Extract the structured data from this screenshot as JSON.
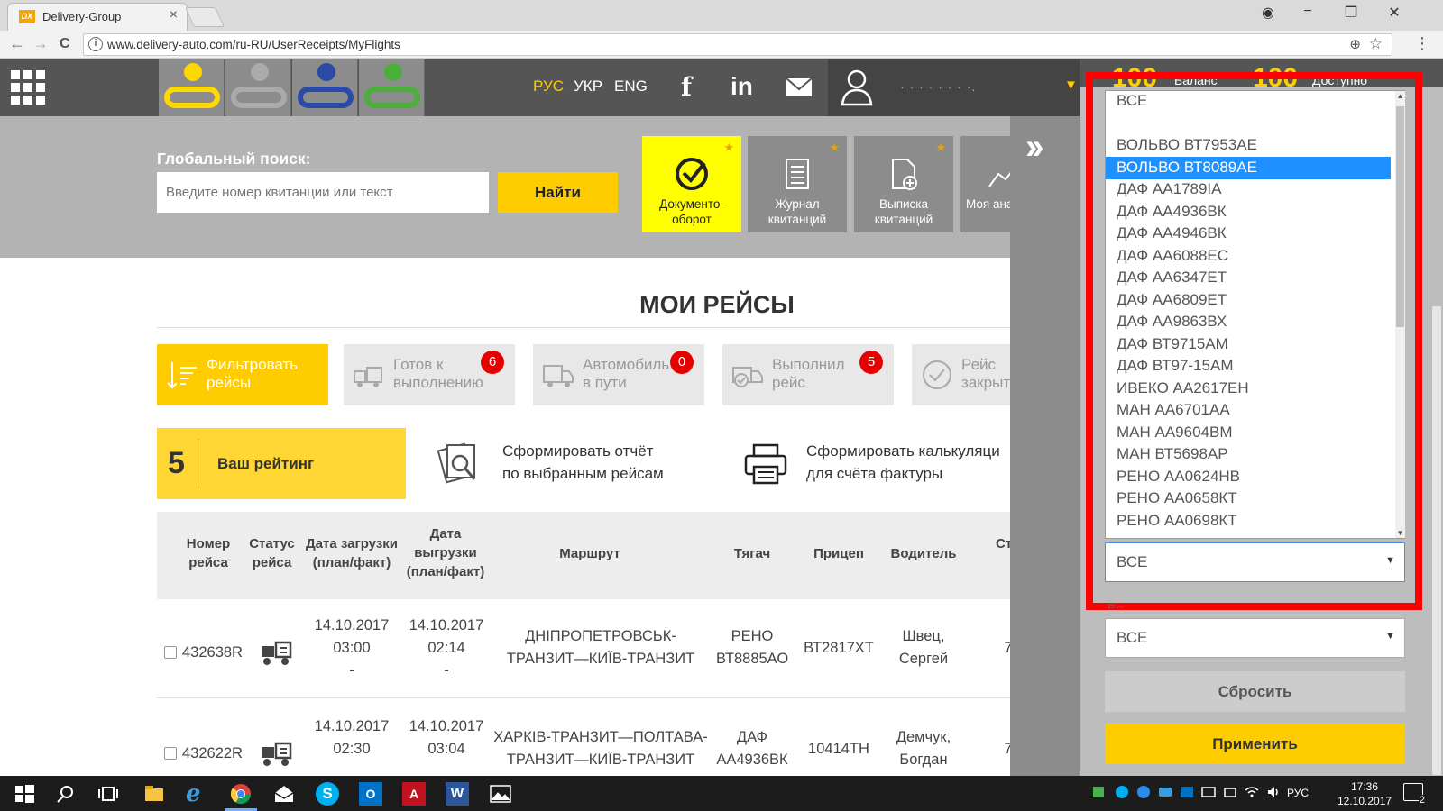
{
  "browser": {
    "tab_title": "Delivery-Group",
    "tab_close": "×",
    "url": "www.delivery-auto.com/ru-RU/UserReceipts/MyFlights",
    "nav_back": "←",
    "nav_forward": "→",
    "nav_reload": "C",
    "zoom_icon": "⊕",
    "star_icon": "☆",
    "menu_icon": "⋮",
    "win_user": "◉",
    "win_min": "−",
    "win_max": "❐",
    "win_close": "✕"
  },
  "header": {
    "lang_ru": "РУС",
    "lang_uk": "УКР",
    "lang_en": "ENG",
    "user_name": "· · ·  ·  ·  ·  · ·.",
    "user_dd": "▼",
    "colors": {
      "accent": "#ffcc00",
      "dark": "#555555"
    }
  },
  "search": {
    "label": "Глобальный поиск:",
    "placeholder": "Введите номер квитанции или текст",
    "button": "Найти"
  },
  "tiles": [
    {
      "l1": "Документо-",
      "l2": "оборот"
    },
    {
      "l1": "Журнал",
      "l2": "квитанций"
    },
    {
      "l1": "Выписка",
      "l2": "квитанций"
    },
    {
      "l1": "Моя ана",
      "l2": ""
    }
  ],
  "page_title": "МОИ РЕЙСЫ",
  "filters": [
    {
      "l1": "Фильтровать",
      "l2": "рейсы",
      "badge": ""
    },
    {
      "l1": "Готов к",
      "l2": "выполнению",
      "badge": "6"
    },
    {
      "l1": "Автомобиль",
      "l2": "в пути",
      "badge": "0"
    },
    {
      "l1": "Выполнил",
      "l2": "рейс",
      "badge": "5"
    },
    {
      "l1": "Рейс",
      "l2": "закрыт",
      "badge": ""
    }
  ],
  "rating": {
    "num": "5",
    "label": "Ваш рейтинг"
  },
  "actions": {
    "report_l1": "Сформировать отчёт",
    "report_l2": "по выбранным рейсам",
    "calc_l1": "Сформировать калькуляци",
    "calc_l2": "для счёта фактуры"
  },
  "table": {
    "headers": {
      "num_l1": "Номер",
      "num_l2": "рейса",
      "status_l1": "Статус",
      "status_l2": "рейса",
      "load_l1": "Дата загрузки",
      "load_l2": "(план/факт)",
      "unload_l1": "Дата",
      "unload_l2": "выгрузки",
      "unload_l3": "(план/факт)",
      "route": "Маршрут",
      "tractor": "Тягач",
      "trailer": "Прицеп",
      "driver": "Водитель",
      "more": "Ст"
    },
    "rows": [
      {
        "num": "432638R",
        "load_date": "14.10.2017",
        "load_time": "03:00",
        "load_fact": "-",
        "unload_date": "14.10.2017",
        "unload_time": "02:14",
        "unload_fact": "-",
        "route_l1": "ДНІПРОПЕТРОВСЬК-",
        "route_l2": "ТРАНЗИТ—КИЇВ-ТРАНЗИТ",
        "tractor_l1": "РЕНО",
        "tractor_l2": "ВТ8885АО",
        "trailer": "ВТ2817ХТ",
        "driver_l1": "Швец,",
        "driver_l2": "Сергей",
        "more": "7"
      },
      {
        "num": "432622R",
        "load_date": "14.10.2017",
        "load_time": "02:30",
        "load_fact": "",
        "unload_date": "14.10.2017",
        "unload_time": "03:04",
        "unload_fact": "",
        "route_l1": "ХАРКІВ-ТРАНЗИТ—ПОЛТАВА-",
        "route_l2": "ТРАНЗИТ—КИЇВ-ТРАНЗИТ",
        "tractor_l1": "ДАФ",
        "tractor_l2": "АА4936ВК",
        "trailer": "10414ТН",
        "driver_l1": "Демчук,",
        "driver_l2": "Богдан",
        "more": "7"
      }
    ]
  },
  "panel": {
    "hdr_num1": "100",
    "hdr_lbl1": "Баланс",
    "hdr_num2": "100",
    "hdr_lbl2": "Доступно",
    "options": [
      "ВСЕ",
      "",
      "ВОЛЬВО ВТ7953АЕ",
      "ВОЛЬВО ВТ8089АЕ",
      "ДАФ АА1789ІА",
      "ДАФ АА4936ВК",
      "ДАФ АА4946ВК",
      "ДАФ АА6088ЕС",
      "ДАФ АА6347ЕТ",
      "ДАФ АА6809ЕТ",
      "ДАФ АА9863ВХ",
      "ДАФ ВТ9715АМ",
      "ДАФ ВТ97-15АМ",
      "ИВЕКО АА2617ЕН",
      "МАН АА6701АА",
      "МАН АА9604ВМ",
      "МАН ВТ5698АР",
      "РЕНО АА0624НВ",
      "РЕНО АА0658КТ",
      "РЕНО АА0698КТ"
    ],
    "selected_index": 3,
    "select1_value": "ВСЕ",
    "field_label": "Во",
    "select2_value": "ВСЕ",
    "reset": "Сбросить",
    "apply": "Применить",
    "caret": "▼",
    "scroll_up": "▲",
    "scroll_down": "▼"
  },
  "taskbar": {
    "lang": "РУС",
    "time": "17:36",
    "date": "12.10.2017",
    "notif_count": "2"
  }
}
